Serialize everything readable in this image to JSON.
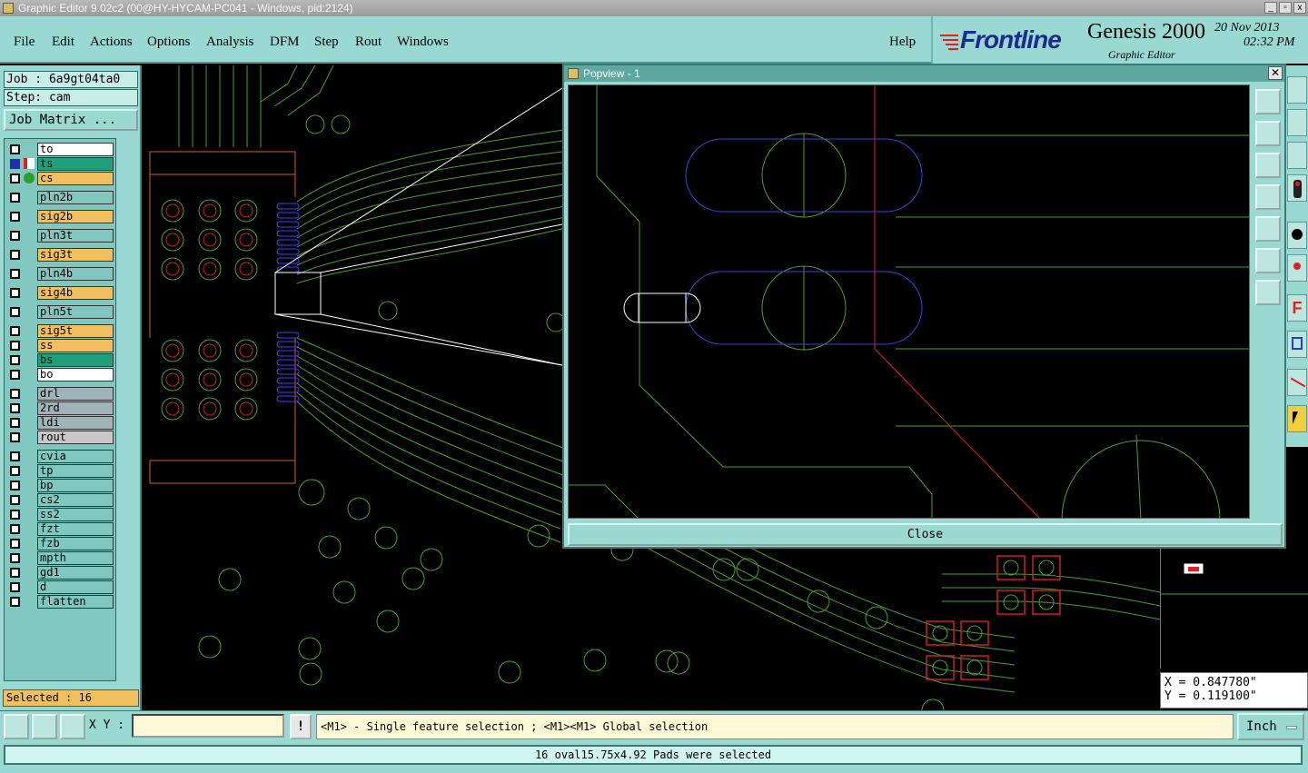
{
  "window": {
    "title": "Graphic Editor 9.02c2 (00@HY-HYCAM-PC041 - Windows, pid:2124)"
  },
  "menu": {
    "items": [
      "File",
      "Edit",
      "Actions",
      "Options",
      "Analysis",
      "DFM",
      "Step",
      "Rout",
      "Windows"
    ],
    "help": "Help"
  },
  "brand": {
    "logo": "Frontline",
    "product": "Genesis 2000",
    "subtitle": "Graphic Editor",
    "date": "20 Nov 2013",
    "time": "02:32 PM"
  },
  "job": {
    "job_label": "Job : 6a9gt04ta0",
    "step_label": "Step: cam",
    "matrix_button": "Job Matrix ..."
  },
  "layers": [
    {
      "name": "to",
      "color": "#ffffff",
      "checked": false
    },
    {
      "name": "ts",
      "color": "#1fa07a",
      "checked": true,
      "icon": "pencil-icon"
    },
    {
      "name": "cs",
      "color": "#f0c060",
      "checked": false,
      "icon": "green-dot-icon"
    },
    {
      "name": "pln2b",
      "color": "#7fc7bf",
      "checked": false
    },
    {
      "name": "sig2b",
      "color": "#f0c060",
      "checked": false
    },
    {
      "name": "pln3t",
      "color": "#7fc7bf",
      "checked": false
    },
    {
      "name": "sig3t",
      "color": "#f0c060",
      "checked": false
    },
    {
      "name": "pln4b",
      "color": "#7fc7bf",
      "checked": false
    },
    {
      "name": "sig4b",
      "color": "#f0c060",
      "checked": false
    },
    {
      "name": "pln5t",
      "color": "#7fc7bf",
      "checked": false
    },
    {
      "name": "sig5t",
      "color": "#f0c060",
      "checked": false
    },
    {
      "name": "ss",
      "color": "#f0c060",
      "checked": false
    },
    {
      "name": "bs",
      "color": "#1fa07a",
      "checked": false
    },
    {
      "name": "bo",
      "color": "#ffffff",
      "checked": false
    },
    {
      "name": "drl",
      "color": "#9fb3bb",
      "checked": false
    },
    {
      "name": "2rd",
      "color": "#9fb3bb",
      "checked": false
    },
    {
      "name": "ldi",
      "color": "#9fb3bb",
      "checked": false
    },
    {
      "name": "rout",
      "color": "#c8c8c8",
      "checked": false
    },
    {
      "name": "cvia",
      "color": "#7fc7bf",
      "checked": false
    },
    {
      "name": "tp",
      "color": "#7fc7bf",
      "checked": false
    },
    {
      "name": "bp",
      "color": "#7fc7bf",
      "checked": false
    },
    {
      "name": "cs2",
      "color": "#7fc7bf",
      "checked": false
    },
    {
      "name": "ss2",
      "color": "#7fc7bf",
      "checked": false
    },
    {
      "name": "fzt",
      "color": "#7fc7bf",
      "checked": false
    },
    {
      "name": "fzb",
      "color": "#7fc7bf",
      "checked": false
    },
    {
      "name": "mpth",
      "color": "#7fc7bf",
      "checked": false
    },
    {
      "name": "gd1",
      "color": "#7fc7bf",
      "checked": false
    },
    {
      "name": "d",
      "color": "#7fc7bf",
      "checked": false
    },
    {
      "name": "flatten",
      "color": "#7fc7bf",
      "checked": false
    }
  ],
  "selection": {
    "label": "Selected : 16"
  },
  "coords": {
    "x": "X = 0.847780\"",
    "y": "Y = 0.119100\""
  },
  "popview": {
    "title": "Popview - 1",
    "close_x": "✕",
    "close_button": "Close"
  },
  "bottom": {
    "xy_label": "X Y :",
    "xy_value": "",
    "bang": "!",
    "hint": "<M1> - Single feature selection ; <M1><M1> Global selection",
    "unit": "Inch",
    "status": "16 oval15.75x4.92 Pads were selected"
  },
  "colors": {
    "panel": "#9ad9d2",
    "trace": "#4aa02a",
    "pad_outline": "#d02020",
    "selected_pad": "#3a3ad0"
  }
}
